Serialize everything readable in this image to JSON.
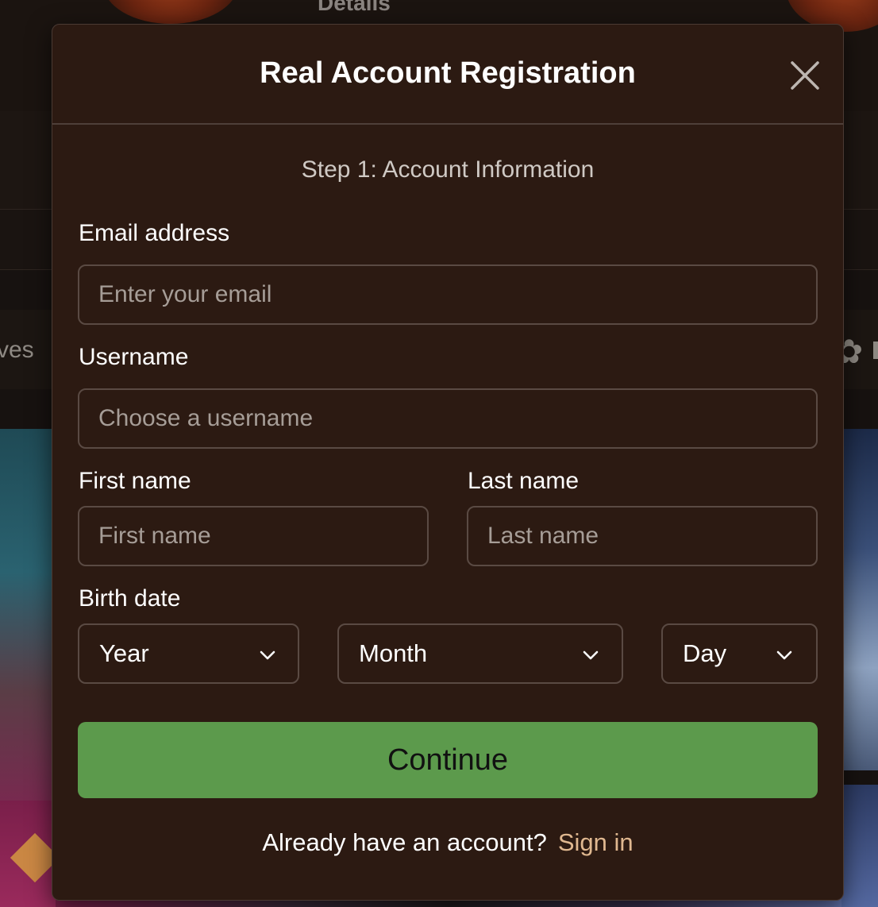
{
  "background": {
    "details_heading": "Details",
    "nav_fragment": "ves"
  },
  "modal": {
    "title": "Real Account Registration",
    "close_icon": "close-icon",
    "step_title": "Step 1: Account Information",
    "email": {
      "label": "Email address",
      "placeholder": "Enter your email",
      "value": ""
    },
    "username": {
      "label": "Username",
      "placeholder": "Choose a username",
      "value": ""
    },
    "first_name": {
      "label": "First name",
      "placeholder": "First name",
      "value": ""
    },
    "last_name": {
      "label": "Last name",
      "placeholder": "Last name",
      "value": ""
    },
    "birth_date": {
      "label": "Birth date",
      "year": "Year",
      "month": "Month",
      "day": "Day",
      "chevron_icon": "chevron-down-icon"
    },
    "continue_label": "Continue",
    "signin_prompt": "Already have an account?",
    "signin_link": "Sign in"
  },
  "colors": {
    "modal_bg": "#2c1a12",
    "accent_green": "#5c9a4c",
    "link": "#e0b890"
  }
}
